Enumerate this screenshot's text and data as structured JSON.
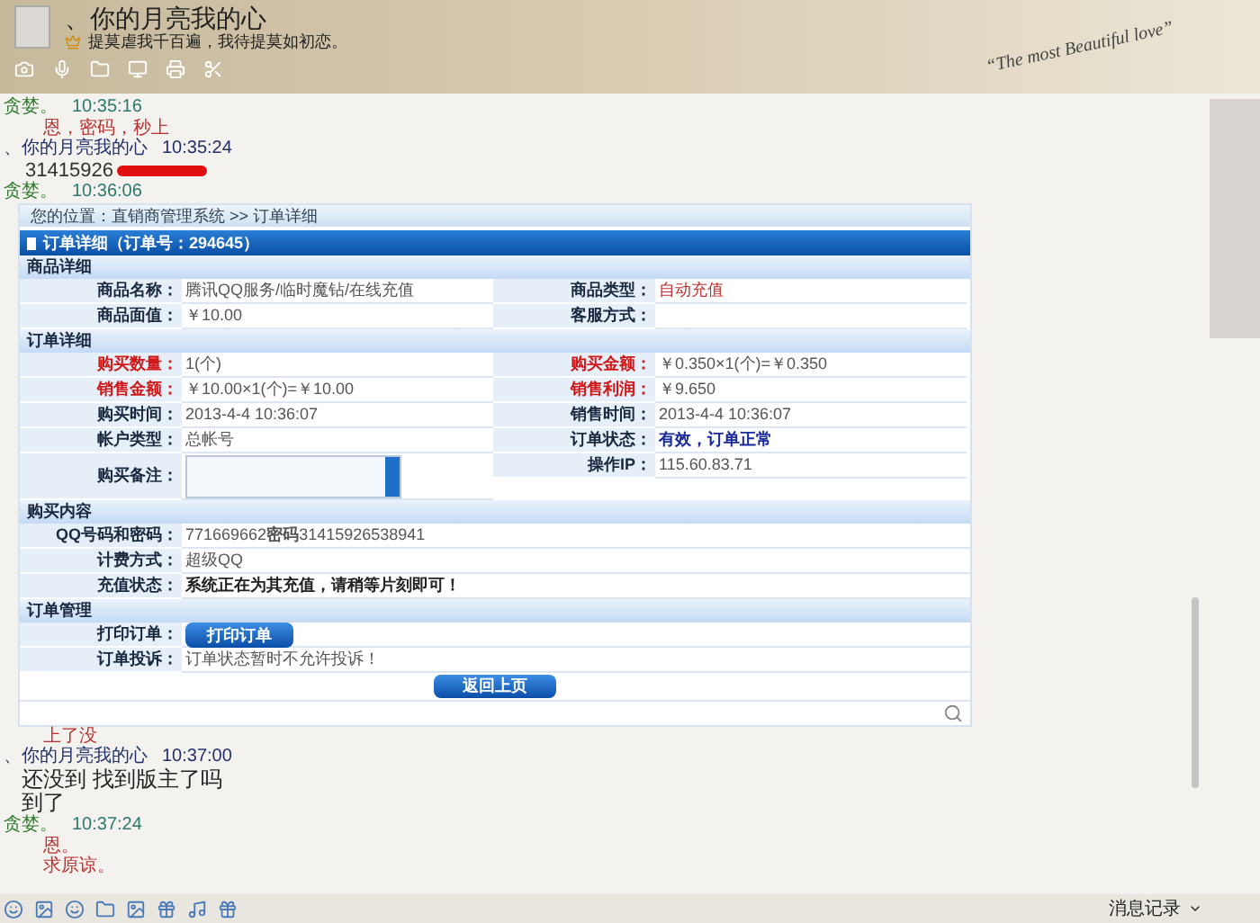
{
  "header": {
    "name": "、你的月亮我的心",
    "signature": "提莫虐我千百遍，我待提莫如初恋。",
    "skin_text": "“The most Beautiful love”"
  },
  "messages": [
    {
      "kind": "sender",
      "name": "贪婪。",
      "time": "10:35:16",
      "self": true
    },
    {
      "kind": "line",
      "text": "恩，密码，秒上",
      "self": true
    },
    {
      "kind": "sender",
      "name": "、你的月亮我的心",
      "time": "10:35:24",
      "self": false
    },
    {
      "kind": "redacted",
      "text": "31415926",
      "self": false
    },
    {
      "kind": "sender",
      "name": "贪婪。",
      "time": "10:36:06",
      "self": true
    },
    {
      "kind": "order"
    },
    {
      "kind": "line",
      "text": "上了没",
      "self": true
    },
    {
      "kind": "sender",
      "name": "、你的月亮我的心",
      "time": "10:37:00",
      "self": false
    },
    {
      "kind": "line",
      "text": "还没到 找到版主了吗",
      "self": false
    },
    {
      "kind": "line",
      "text": "到了",
      "self": false
    },
    {
      "kind": "sender",
      "name": "贪婪。",
      "time": "10:37:24",
      "self": true
    },
    {
      "kind": "line",
      "text": "恩。",
      "self": true
    },
    {
      "kind": "line",
      "text": "求原谅。",
      "self": true
    }
  ],
  "order": {
    "breadcrumb": "您的位置：直销商管理系统 >> 订单详细",
    "title": "订单详细（订单号：294645）",
    "sections": [
      {
        "title": "商品详细",
        "rows": [
          [
            {
              "label": "商品名称：",
              "value": "腾讯QQ服务/临时魔钻/在线充值",
              "alert": false,
              "kind": "text"
            },
            {
              "label": "商品类型：",
              "value": "自动充值",
              "alert": false,
              "kind": "red"
            }
          ],
          [
            {
              "label": "商品面值：",
              "value": "￥10.00",
              "alert": false,
              "kind": "text"
            },
            {
              "label": "客服方式：",
              "alert": false,
              "kind": "text"
            }
          ]
        ]
      },
      {
        "title": "订单详细",
        "rows": [
          [
            {
              "label": "购买数量：",
              "value": "1(个)",
              "alert": true,
              "kind": "text"
            },
            {
              "label": "购买金额：",
              "value": "￥0.350×1(个)=￥0.350",
              "alert": true,
              "kind": "text"
            }
          ],
          [
            {
              "label": "销售金额：",
              "value": "￥10.00×1(个)=￥10.00",
              "alert": true,
              "kind": "text"
            },
            {
              "label": "销售利润：",
              "value": "￥9.650",
              "alert": true,
              "kind": "text"
            }
          ],
          [
            {
              "label": "购买时间：",
              "value": "2013-4-4 10:36:07",
              "alert": false,
              "kind": "text"
            },
            {
              "label": "销售时间：",
              "value": "2013-4-4 10:36:07",
              "alert": false,
              "kind": "text"
            }
          ],
          [
            {
              "label": "帐户类型：",
              "value": "总帐号",
              "alert": false,
              "kind": "text"
            },
            {
              "label": "订单状态：",
              "value": "有效，订单正常",
              "alert": false,
              "kind": "status"
            }
          ],
          [
            {
              "label": "购买备注：",
              "alert": false,
              "kind": "textarea"
            },
            {
              "label": "操作IP：",
              "value": "115.60.83.71",
              "alert": false,
              "kind": "text"
            }
          ]
        ]
      },
      {
        "title": "购买内容",
        "rows": [
          [
            {
              "label": "QQ号码和密码：",
              "value": "771669662**密码**31415926538941",
              "alert": false,
              "kind": "text"
            }
          ],
          [
            {
              "label": "计费方式：",
              "value": "超级QQ",
              "alert": false,
              "kind": "text"
            }
          ],
          [
            {
              "label": "充值状态：",
              "value": "系统正在为其充值，请稍等片刻即可！",
              "alert": false,
              "kind": "bold"
            }
          ]
        ]
      },
      {
        "title": "订单管理",
        "rows": [
          [
            {
              "label": "打印订单：",
              "value": "打印订单",
              "alert": false,
              "kind": "button"
            }
          ],
          [
            {
              "label": "订单投诉：",
              "value": "订单状态暂时不允许投诉！",
              "alert": false,
              "kind": "text"
            }
          ]
        ]
      }
    ],
    "back_button": "返回上页"
  },
  "footer": {
    "history": "消息记录"
  }
}
